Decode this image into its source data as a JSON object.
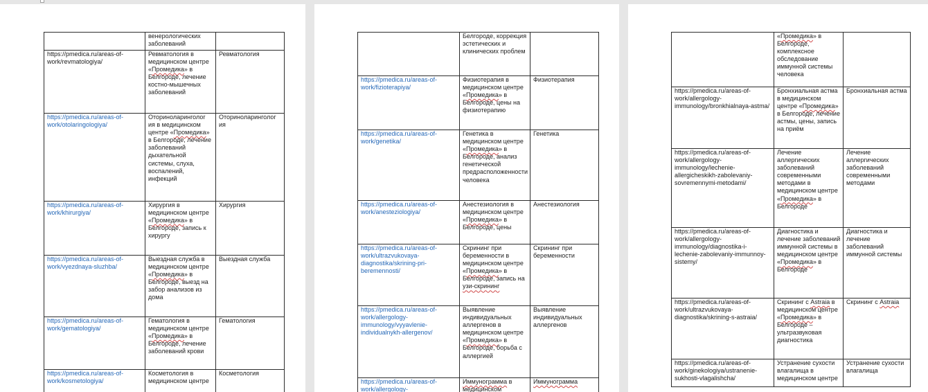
{
  "pages": [
    {
      "rows": [
        {
          "url": "",
          "desc": "венерологических заболеваний",
          "name": "",
          "blue": false
        },
        {
          "url": "https://pmedica.ru/areas-of-work/revmatologiya/",
          "desc": "Ревматология в медицинском центре «Промедика» в Белгороде, лечение костно-мышечных заболеваний",
          "name": "Ревматология",
          "blue": false
        },
        {
          "url": "https://pmedica.ru/areas-of-work/otolaringologiya/",
          "desc": "Оториноларинголог ия в медицинском центре «Промедика» в Белгороде, лечение заболеваний дыхательной системы, слуха, воспалений, инфекций",
          "name": "Оториноларинголог\nия",
          "blue": true
        },
        {
          "url": "https://pmedica.ru/areas-of-work/khirurgiya/",
          "desc": "Хирургия в медицинском центре «Промедика» в Белгороде, запись к хирургу",
          "name": "Хирургия",
          "blue": true
        },
        {
          "url": "https://pmedica.ru/areas-of-work/vyezdnaya-sluzhba/",
          "desc": "Выездная служба в медицинском центре «Промедика» в Белгороде, выезд на забор анализов из дома",
          "name": "Выездная служба",
          "blue": true
        },
        {
          "url": "https://pmedica.ru/areas-of-work/gematologiya/",
          "desc": "Гематология в медицинском центре «Промедика» в Белгороде, лечение заболеваний крови",
          "name": "Гематология",
          "blue": true
        },
        {
          "url": "https://pmedica.ru/areas-of-work/kosmetologiya/",
          "desc": "Косметология в медицинском центре",
          "name": "Косметология",
          "blue": true
        }
      ]
    },
    {
      "rows": [
        {
          "url": "",
          "desc": "Белгороде, коррекция эстетических и клинических проблем",
          "name": "",
          "blue": false
        },
        {
          "url": "https://pmedica.ru/areas-of-work/fizioterapiya/",
          "desc": "Физиотерапия в медицинском центре «Промедика» в Белгороде, цены на физиотерапию",
          "name": "Физиотерапия",
          "blue": true
        },
        {
          "url": "https://pmedica.ru/areas-of-work/genetika/",
          "desc": "Генетика в медицинском центре «Промедика» в Белгороде, анализ генетической предрасположенности человека",
          "name": "Генетика",
          "blue": true
        },
        {
          "url": "https://pmedica.ru/areas-of-work/anesteziologiya/",
          "desc": "Анестезиология в медицинском центре «Промедика» в Белгороде, цены",
          "name": "Анестезиология",
          "blue": true
        },
        {
          "url": "https://pmedica.ru/areas-of-work/ultrazvukovaya-diagnostika/skrining-pri-beremennosti/",
          "desc": "Скрининг при беременности в медицинском центре «Промедика» в Белгороде, запись на узи-скрининг",
          "name": "Скрининг при беременности",
          "blue": true
        },
        {
          "url": "https://pmedica.ru/areas-of-work/allergology-immunology/vyyavlenie-individualnykh-allergenov/",
          "desc": "Выявление индивидуальных аллергенов в медицинском центре «Промедика» в Белгороде, борьба с аллергией",
          "name": "Выявление индивидуальных аллергенов",
          "blue": true
        },
        {
          "url": "https://pmedica.ru/areas-of-work/allergology-",
          "desc": "Иммунограмма в медицинском",
          "name": "Иммунограмма",
          "blue": true
        }
      ]
    },
    {
      "rows": [
        {
          "url": "",
          "desc": "«Промедика» в Белгороде, комплексное обследование иммунной системы человека",
          "name": "",
          "blue": false
        },
        {
          "url": "https://pmedica.ru/areas-of-work/allergology-immunology/bronkhialnaya-astma/",
          "desc": "Бронхиальная астма в медицинском центре «Промедика» в Белгороде, лечение астмы, цены, запись на приём",
          "name": "Бронхиальная астма",
          "blue": false
        },
        {
          "url": "https://pmedica.ru/areas-of-work/allergology-immunology/lechenie-allergicheskikh-zabolevaniy-sovremennymi-metodami/",
          "desc": "Лечение аллергических заболеваний современными методами в медицинском центре «Промедика» в Белгороде",
          "name": "Лечение аллергических заболеваний современными методами",
          "blue": false
        },
        {
          "url": "https://pmedica.ru/areas-of-work/allergology-immunology/diagnostika-i-lechenie-zabolevaniy-immunnoy-sistemy/",
          "desc": "Диагностика и лечение заболеваний иммунной системы в медицинском центре «Промедика» в Белгороде",
          "name": "Диагностика и лечение заболеваний иммунной системы",
          "blue": false
        },
        {
          "url": "https://pmedica.ru/areas-of-work/ultrazvukovaya-diagnostika/skrining-s-astraia/",
          "desc": "Скрининг с Astraia в медицинском центре «Промедика» в Белгороде – ультразвуковая диагностика",
          "name": "Скрининг с Astraia",
          "blue": false
        },
        {
          "url": "https://pmedica.ru/areas-of-work/ginekologiya/ustranenie-sukhosti-vlagalishcha/",
          "desc": "Устранение сухости влагалища в медицинском центре",
          "name": "Устранение сухости влагалища",
          "blue": false
        }
      ]
    }
  ]
}
